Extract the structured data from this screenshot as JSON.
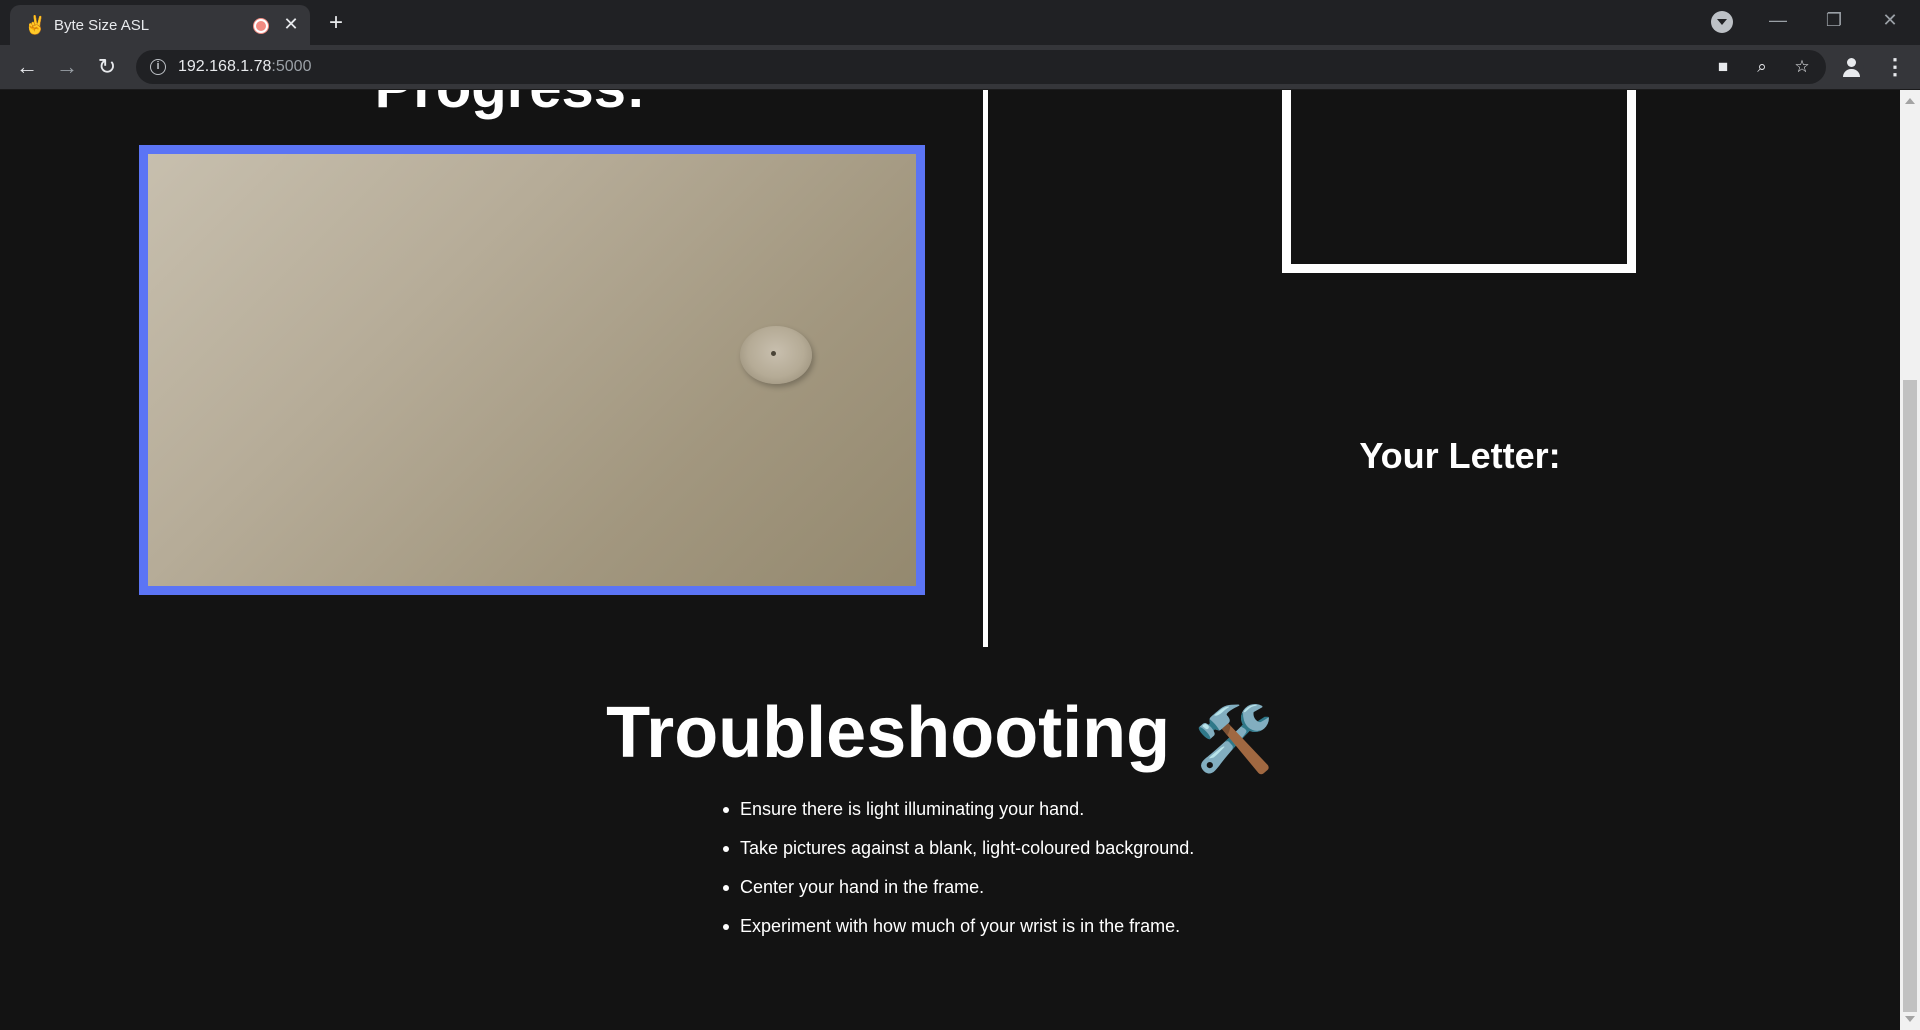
{
  "browser": {
    "tab": {
      "favicon": "✌",
      "title": "Byte Size ASL",
      "recording_icon": "recording-icon",
      "close_glyph": "✕"
    },
    "new_tab_glyph": "+",
    "window_controls": {
      "minimize": "—",
      "maximize": "❐",
      "close": "✕"
    },
    "nav": {
      "back": "←",
      "forward": "→",
      "reload": "↻"
    },
    "address": {
      "host": "192.168.1.78",
      "port": ":5000",
      "info_glyph": "i"
    },
    "omnibox_icons": {
      "camera": "■",
      "zoom": "⌕",
      "bookmark": "☆"
    },
    "menu_glyph": "⋮"
  },
  "page": {
    "progress_heading": "Progress:",
    "your_letter_heading": "Your Letter:",
    "troubleshooting": {
      "heading": "Troubleshooting",
      "emoji": "🛠️",
      "tips": [
        "Ensure there is light illuminating your hand.",
        "Take pictures against a blank, light-coloured background.",
        "Center your hand in the frame.",
        "Experiment with how much of your wrist is in the frame."
      ]
    }
  },
  "colors": {
    "page_background": "#131313",
    "camera_frame_border": "#5b74f5",
    "text": "#ffffff"
  }
}
